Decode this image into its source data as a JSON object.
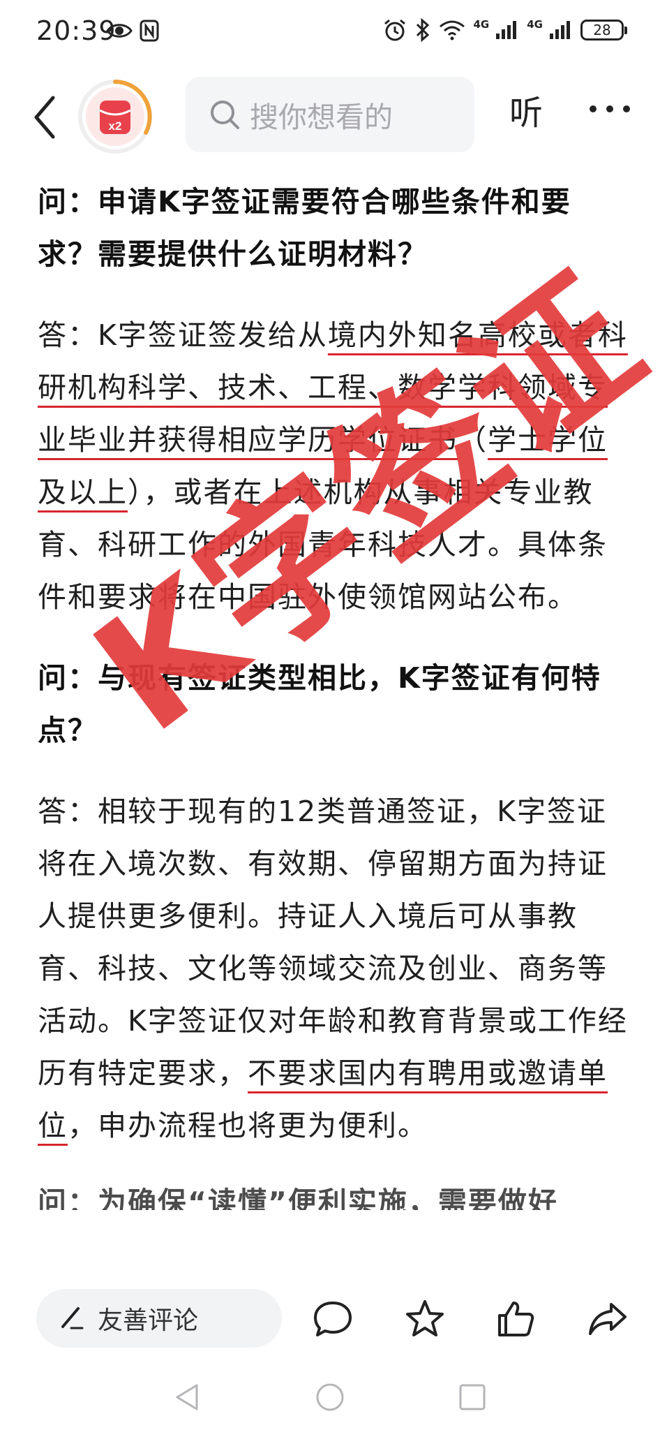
{
  "status_bar": {
    "time": "20:39",
    "network_1": "4G",
    "network_2": "4G",
    "battery": "28"
  },
  "nav": {
    "search_placeholder": "搜你想看的",
    "listen_label": "听",
    "redpacket_badge": "x2"
  },
  "article": {
    "q1": "问：申请K字签证需要符合哪些条件和要求？需要提供什么证明材料？",
    "a1_prefix": "答：K字签证签发给从",
    "a1_underlined": "境内外知名高校或者科研机构科学、技术、工程、数学学科领域专业毕业并获得相应学历学位证书",
    "a1_mid": "（",
    "a1_underlined_2": "学士学位及以上",
    "a1_suffix": "），或者在上述机构从事相关专业教育、科研工作的外国青年科技人才。具体条件和要求将在中国驻外使领馆网站公布。",
    "q2": "问：与现有签证类型相比，K字签证有何特点？",
    "a2_prefix": "答：相较于现有的12类普通签证，K字签证将在入境次数、有效期、停留期方面为持证人提供更多便利。持证人入境后可从事教育、科技、文化等领域交流及创业、商务等活动。K字签证仅对年龄和教育背景或工作经历有特定要求，",
    "a2_underlined": "不要求国内有聘用或邀请单位",
    "a2_suffix": "，申办流程也将更为便利。",
    "q3_partial": "问：为确保“读懂”便利实施，需要做好"
  },
  "stamp": {
    "text": "K字签证"
  },
  "bottom_bar": {
    "comment_label": "友善评论"
  },
  "colors": {
    "stamp_red": "#e33b3b",
    "underline_red": "#d8262d",
    "redpacket_red": "#e8414b",
    "ring_orange": "#f0a23a"
  },
  "icons": [
    "eye-icon",
    "nfc-icon",
    "alarm-icon",
    "bluetooth-icon",
    "wifi-icon",
    "signal-icon",
    "battery-icon",
    "back-icon",
    "redpacket-icon",
    "search-icon",
    "more-icon",
    "pen-icon",
    "comment-icon",
    "star-icon",
    "like-icon",
    "share-icon",
    "nav-back-icon",
    "nav-home-icon",
    "nav-recent-icon"
  ]
}
